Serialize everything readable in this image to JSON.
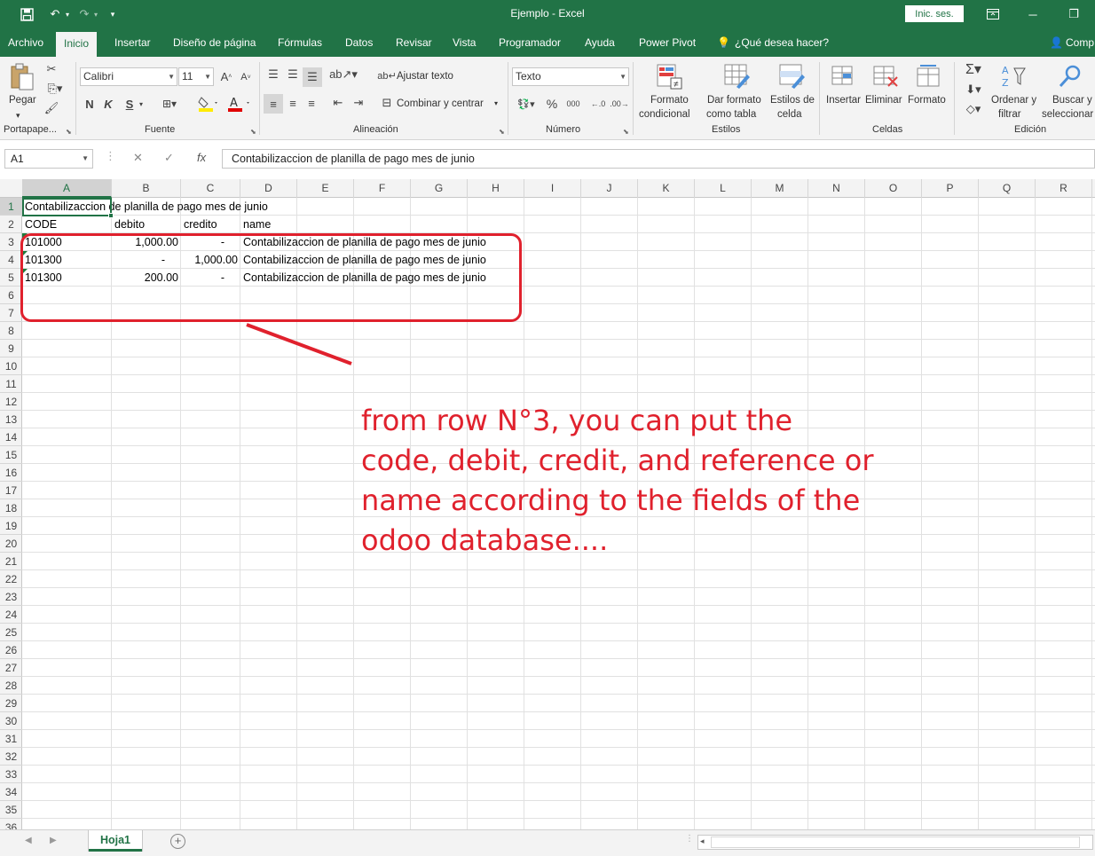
{
  "window": {
    "title": "Ejemplo  -  Excel",
    "signin_label": "Inic. ses."
  },
  "menu": {
    "tabs": [
      "Archivo",
      "Inicio",
      "Insertar",
      "Diseño de página",
      "Fórmulas",
      "Datos",
      "Revisar",
      "Vista",
      "Programador",
      "Ayuda",
      "Power Pivot",
      "¿Qué desea hacer?",
      "Comp"
    ],
    "active_tab": "Inicio"
  },
  "ribbon": {
    "clipboard": {
      "paste_label": "Pegar",
      "group_label": "Portapape..."
    },
    "font": {
      "font_name": "Calibri",
      "font_size": "11",
      "bold": "N",
      "italic": "K",
      "underline": "S",
      "group_label": "Fuente"
    },
    "alignment": {
      "wrap_text": "Ajustar texto",
      "merge_center": "Combinar y centrar",
      "group_label": "Alineación"
    },
    "number": {
      "format": "Texto",
      "percent": "%",
      "thousands": "000",
      "group_label": "Número"
    },
    "styles": {
      "conditional_1": "Formato",
      "conditional_2": "condicional",
      "table_1": "Dar formato",
      "table_2": "como tabla",
      "cell_1": "Estilos de",
      "cell_2": "celda",
      "group_label": "Estilos"
    },
    "cells": {
      "insert": "Insertar",
      "delete": "Eliminar",
      "format": "Formato",
      "group_label": "Celdas"
    },
    "editing": {
      "sort_1": "Ordenar y",
      "sort_2": "filtrar",
      "find_1": "Buscar y",
      "find_2": "seleccionar",
      "group_label": "Edición"
    }
  },
  "formula_bar": {
    "name_box": "A1",
    "formula": "Contabilizaccion de planilla de pago mes de junio"
  },
  "sheet": {
    "columns": [
      "A",
      "B",
      "C",
      "D",
      "E",
      "F",
      "G",
      "H",
      "I",
      "J",
      "K",
      "L",
      "M",
      "N",
      "O",
      "P",
      "Q",
      "R"
    ],
    "row_count": 36,
    "selected_cell": "A1",
    "cells": {
      "A1": "Contabilizaccion de planilla de pago mes de junio",
      "A2": "CODE",
      "B2": "debito",
      "C2": "credito",
      "D2": "name",
      "A3": "101000",
      "B3": "1,000.00",
      "C3": "-",
      "D3": "Contabilizaccion de planilla de pago mes de junio",
      "A4": "101300",
      "B4": "-",
      "C4": "1,000.00",
      "D4": "Contabilizaccion de planilla de pago mes de junio",
      "A5": "101300",
      "B5": "200.00",
      "C5": "-",
      "D5": "Contabilizaccion de planilla de pago mes de junio"
    },
    "tab_name": "Hoja1"
  },
  "annotation": {
    "text": "from row N°3, you can put the code, debit, credit, and reference or name according to the fields of the odoo database....",
    "color": "#e0212d"
  },
  "colors": {
    "excel_green": "#217346"
  }
}
